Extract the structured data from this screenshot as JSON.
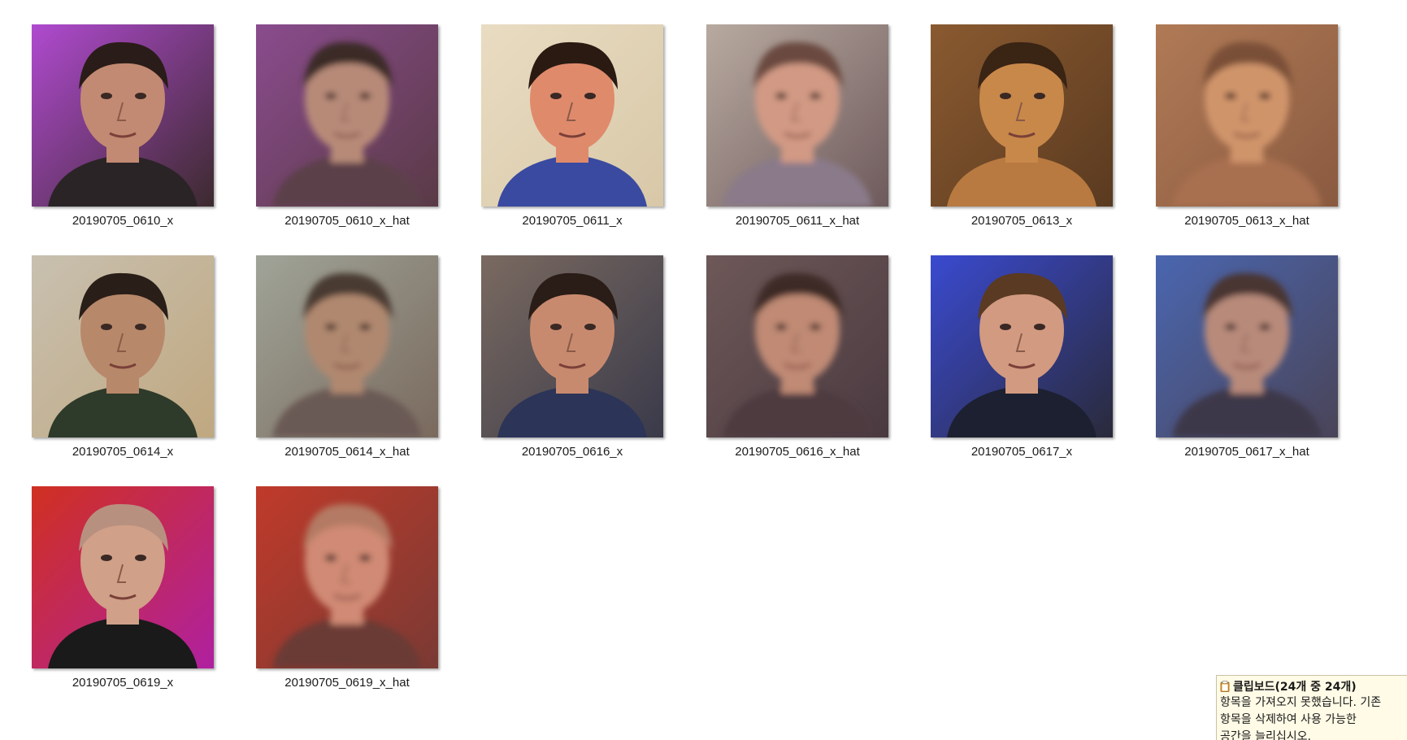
{
  "files": [
    {
      "name": "20190705_0610_x",
      "kind": "x",
      "bg": "#b04ad0",
      "bg2": "#3c2a2e",
      "skin": "#c28a72",
      "hair": "#2a1c18",
      "shirt": "#2b2426"
    },
    {
      "name": "20190705_0610_x_hat",
      "kind": "x_hat",
      "bg": "#8a4c8e",
      "bg2": "#5a3a46",
      "skin": "#b78a78",
      "hair": "#3a2a28",
      "shirt": "#5c4048"
    },
    {
      "name": "20190705_0611_x",
      "kind": "x",
      "bg": "#e9dcc2",
      "bg2": "#d8c8a8",
      "skin": "#e08a6c",
      "hair": "#2a1a12",
      "shirt": "#3a4aa0"
    },
    {
      "name": "20190705_0611_x_hat",
      "kind": "x_hat",
      "bg": "#b8aaa0",
      "bg2": "#6e5a5c",
      "skin": "#d29a84",
      "hair": "#6a4a40",
      "shirt": "#8a7a8a"
    },
    {
      "name": "20190705_0613_x",
      "kind": "x",
      "bg": "#8a5a30",
      "bg2": "#5a3a20",
      "skin": "#c8884a",
      "hair": "#3a2414",
      "shirt": "#b87a40"
    },
    {
      "name": "20190705_0613_x_hat",
      "kind": "x_hat",
      "bg": "#b07a56",
      "bg2": "#8a5a40",
      "skin": "#d0946a",
      "hair": "#7a5038",
      "shirt": "#a87050"
    },
    {
      "name": "20190705_0614_x",
      "kind": "x",
      "bg": "#c8c0b0",
      "bg2": "#c0a880",
      "skin": "#b8886a",
      "hair": "#2a1e18",
      "shirt": "#2e3a2a"
    },
    {
      "name": "20190705_0614_x_hat",
      "kind": "x_hat",
      "bg": "#a0a498",
      "bg2": "#7a6a5e",
      "skin": "#b08870",
      "hair": "#4a3a30",
      "shirt": "#6a5a54"
    },
    {
      "name": "20190705_0616_x",
      "kind": "x",
      "bg": "#7a6a60",
      "bg2": "#3a3a4a",
      "skin": "#c88a6e",
      "hair": "#2a1c16",
      "shirt": "#2c3458"
    },
    {
      "name": "20190705_0616_x_hat",
      "kind": "x_hat",
      "bg": "#6e5858",
      "bg2": "#4a3a40",
      "skin": "#c08a74",
      "hair": "#3e2c28",
      "shirt": "#4e3a40"
    },
    {
      "name": "20190705_0617_x",
      "kind": "x",
      "bg": "#3a4ad0",
      "bg2": "#2a2a3a",
      "skin": "#d29a80",
      "hair": "#5a3a22",
      "shirt": "#1c2030"
    },
    {
      "name": "20190705_0617_x_hat",
      "kind": "x_hat",
      "bg": "#4a66b0",
      "bg2": "#4a4458",
      "skin": "#b88a7a",
      "hair": "#4a3632",
      "shirt": "#3c3848"
    },
    {
      "name": "20190705_0619_x",
      "kind": "x",
      "bg": "#d03020",
      "bg2": "#b020a0",
      "skin": "#d0a088",
      "hair": "#b89080",
      "shirt": "#1a1a1a"
    },
    {
      "name": "20190705_0619_x_hat",
      "kind": "x_hat",
      "bg": "#c03a2a",
      "bg2": "#7a3a34",
      "skin": "#d08a74",
      "hair": "#b47a64",
      "shirt": "#6a3a34"
    }
  ],
  "clipboard": {
    "title": "클립보드(24개 중 24개)",
    "line1": "항목을 가져오지 못했습니다. 기존",
    "line2": "항목을 삭제하여 사용 가능한",
    "line3": "공간을 늘리십시오.",
    "icon": "clipboard-icon",
    "bg_color": "#fffbe6"
  }
}
